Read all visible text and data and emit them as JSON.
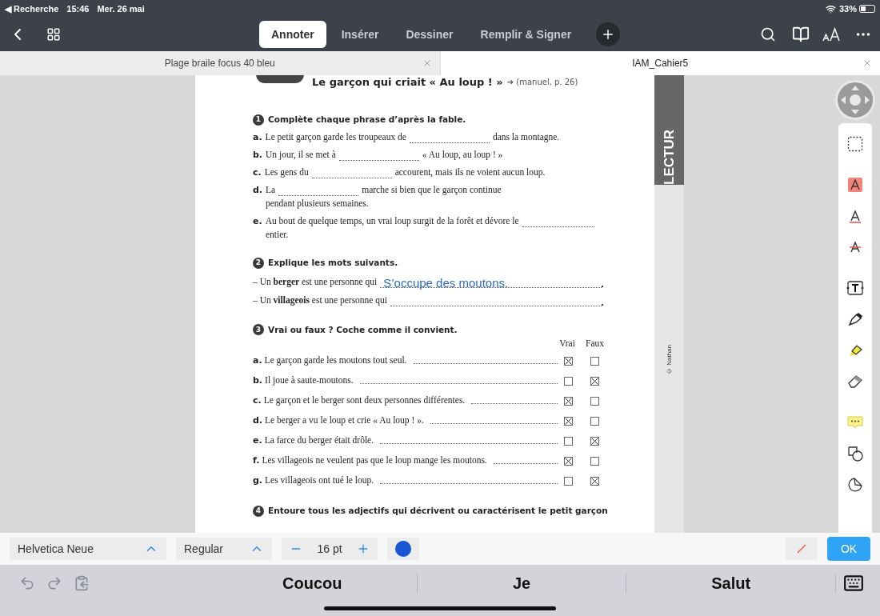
{
  "status_bar": {
    "back": "◀ Recherche",
    "time": "15:46",
    "date": "Mer. 26 mai",
    "battery": "33%"
  },
  "toolbar": {
    "tabs": [
      {
        "label": "Annoter",
        "selected": true
      },
      {
        "label": "Insérer",
        "selected": false
      },
      {
        "label": "Dessiner",
        "selected": false
      },
      {
        "label": "Remplir & Signer",
        "selected": false
      }
    ]
  },
  "document_tabs": [
    {
      "title": "Plage braile focus 40 bleu",
      "selected": false
    },
    {
      "title": "IAM_Cahier5",
      "selected": true
    }
  ],
  "page": {
    "title": "Le garçon qui criait « Au loup ! »",
    "reference": "➔ (manuel, p. 26)",
    "exercise_1": {
      "number": "1",
      "heading": "Complète chaque phrase d’après la fable.",
      "items": [
        {
          "letter": "a.",
          "before": "Le petit garçon garde les troupeaux de",
          "after": "dans la montagne."
        },
        {
          "letter": "b.",
          "before": "Un jour, il se met à",
          "after": "« Au loup, au loup ! »"
        },
        {
          "letter": "c.",
          "before": "Les gens du",
          "after": "accourent, mais ils ne voient aucun loup."
        },
        {
          "letter": "d.",
          "before": "La",
          "after": "marche si bien que le garçon continue",
          "continuation": "pendant plusieurs semaines."
        },
        {
          "letter": "e.",
          "before": "Au bout de quelque temps, un vrai loup surgit de la forêt et dévore le",
          "continuation": "entier."
        }
      ]
    },
    "exercise_2": {
      "number": "2",
      "heading": "Explique les mots suivants.",
      "lines": [
        {
          "text": "– Un **berger** est une personne qui",
          "answer": "S’occupe des moutons."
        },
        {
          "text": "– Un **villageois** est une personne qui"
        }
      ]
    },
    "exercise_3": {
      "number": "3",
      "heading": "Vrai ou faux ? Coche comme il convient.",
      "columns": [
        "Vrai",
        "Faux"
      ],
      "rows": [
        {
          "letter": "a.",
          "text": "Le garçon garde les moutons tout seul.",
          "vrai_checked": true,
          "faux_checked": false
        },
        {
          "letter": "b.",
          "text": "Il joue à saute-moutons.",
          "vrai_checked": false,
          "faux_checked": true
        },
        {
          "letter": "c.",
          "text": "Le garçon et le berger sont deux personnes différentes.",
          "vrai_checked": true,
          "faux_checked": false
        },
        {
          "letter": "d.",
          "text": "Le berger a vu le loup et crie « Au loup ! ».",
          "vrai_checked": true,
          "faux_checked": false
        },
        {
          "letter": "e.",
          "text": "La farce du berger était drôle.",
          "vrai_checked": false,
          "faux_checked": true
        },
        {
          "letter": "f.",
          "text": "Les villageois ne veulent pas que le loup mange les moutons.",
          "vrai_checked": true,
          "faux_checked": false
        },
        {
          "letter": "g.",
          "text": "Les villageois ont tué le loup.",
          "vrai_checked": false,
          "faux_checked": true
        }
      ]
    },
    "exercise_4": {
      "number": "4",
      "heading": "Entoure tous les adjectifs qui décrivent ou caractérisent le petit garçon"
    },
    "side_tab": "LECTUR",
    "copyright": "© Nathan"
  },
  "format_bar": {
    "font": "Helvetica Neue",
    "weight": "Regular",
    "size": "16 pt",
    "color": "#1b55d4",
    "confirm": "OK"
  },
  "suggestions": [
    "Coucou",
    "Je",
    "Salut"
  ]
}
